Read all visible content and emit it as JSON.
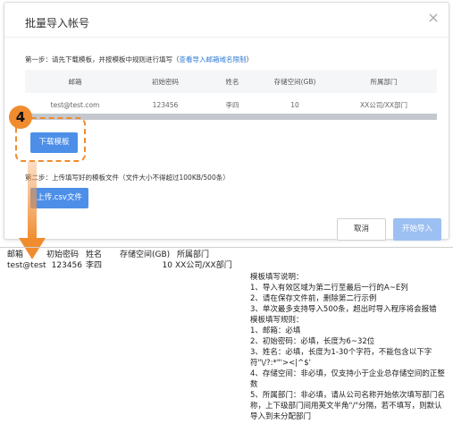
{
  "dialog": {
    "title": "批量导入帐号",
    "step1_text": "第一步：请先下载模板，并按模板中规则进行填写（",
    "step1_link": "查看导入邮箱域名限制",
    "step1_suffix": "）",
    "table": {
      "headers": [
        "邮箱",
        "初始密码",
        "姓名",
        "存储空间(GB)",
        "所属部门"
      ],
      "row": [
        "test@test.com",
        "123456",
        "李四",
        "10",
        "XX公司/XX部门"
      ]
    },
    "download_label": "下载模板",
    "step2_text": "第二步：上传填写好的模板文件（文件大小不得超过100KB/500条）",
    "upload_label": "上传.csv文件",
    "cancel_label": "取消",
    "start_label": "开始导入"
  },
  "annotation": {
    "step_number": "4",
    "accent_color": "#f08c2e"
  },
  "sheet": {
    "headers": [
      "邮箱",
      "初始密码",
      "姓名",
      "存储空间(GB)",
      "所属部门"
    ],
    "row": {
      "email": "test@test.c",
      "password": "123456",
      "name": "李四",
      "storage": "10",
      "dept": "XX公司/XX部门"
    },
    "notes": [
      "模板填写说明：",
      "1、导入有效区域为第二行至最后一行的A~E列",
      "2、请在保存文件前，删除第二行示例",
      "3、单次最多支持导入500条，超出时导入程序将会报错",
      "模板填写规则：",
      "1、邮箱：必填",
      "2、初始密码：必填，长度为6~32位",
      "3、姓名：必填，长度为1-30个字符，不能包含以下字符\"\\/?:*\"'><|^$'",
      "4、存储空间：非必填，仅支持小于企业总存储空间的正整数",
      "5、所属部门：非必填，请从公司名称开始依次填写部门名称，上下级部门间用英文半角\"/\"分隔，若不填写，则默认导入到未分配部门"
    ]
  }
}
